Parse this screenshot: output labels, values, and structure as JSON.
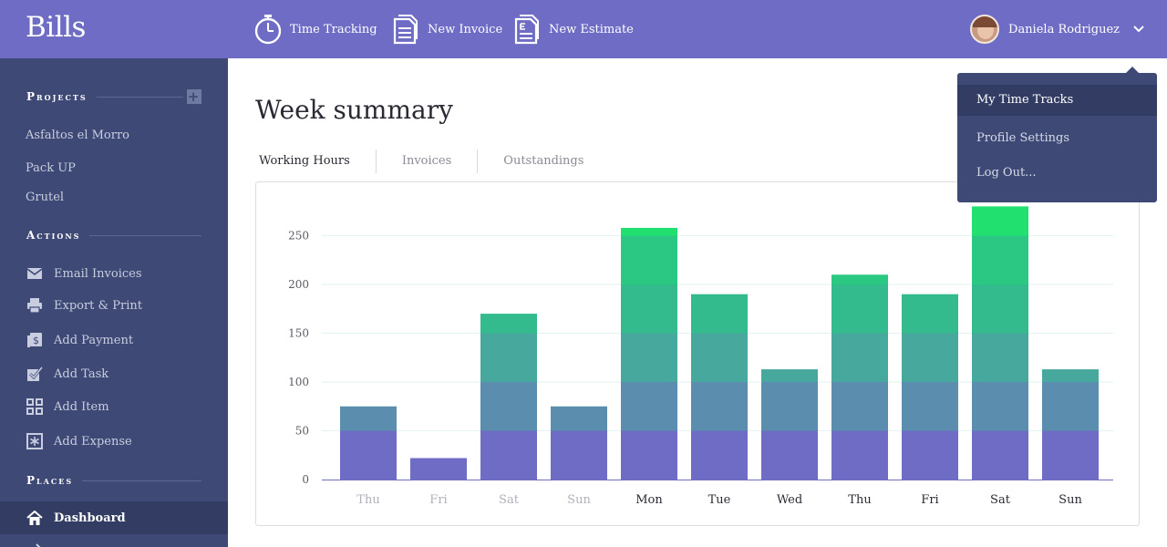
{
  "app": {
    "logo": "Bills"
  },
  "topnav": [
    {
      "label": "Time Tracking",
      "icon": "stopwatch-icon"
    },
    {
      "label": "New Invoice",
      "icon": "document-icon"
    },
    {
      "label": "New Estimate",
      "icon": "estimate-document-icon"
    }
  ],
  "user": {
    "name": "Daniela Rodriguez"
  },
  "sidebar": {
    "projects_heading": "Projects",
    "projects": [
      "Asfaltos el Morro",
      "Pack UP",
      "Grutel"
    ],
    "actions_heading": "Actions",
    "actions": [
      {
        "label": "Email Invoices",
        "icon": "envelope-icon"
      },
      {
        "label": "Export & Print",
        "icon": "printer-icon"
      },
      {
        "label": "Add Payment",
        "icon": "payment-icon"
      },
      {
        "label": "Add Task",
        "icon": "task-check-icon"
      },
      {
        "label": "Add Item",
        "icon": "grid-icon"
      },
      {
        "label": "Add Expense",
        "icon": "expense-icon"
      }
    ],
    "places_heading": "Places",
    "places": [
      {
        "label": "Dashboard",
        "icon": "home-icon"
      }
    ]
  },
  "main": {
    "title": "Week summary",
    "tabs": [
      "Working Hours",
      "Invoices",
      "Outstandings"
    ],
    "active_tab": "Working Hours"
  },
  "dropdown": {
    "items": [
      "My Time Tracks",
      "Profile Settings",
      "Log Out..."
    ],
    "active": "My Time Tracks"
  },
  "colors": {
    "topbar": "#6e6cc4",
    "sidebar": "#3e4a75",
    "band_0_50": "#6e6cc4",
    "band_50_100": "#5a8dae",
    "band_100_150": "#47a99d",
    "band_150_200": "#33bb8e",
    "band_200_250": "#2ac882",
    "band_250_plus": "#22e070"
  },
  "chart_data": {
    "type": "bar",
    "categories": [
      "Thu",
      "Fri",
      "Sat",
      "Sun",
      "Mon",
      "Tue",
      "Wed",
      "Thu",
      "Fri",
      "Sat",
      "Sun"
    ],
    "values": [
      75,
      22,
      170,
      75,
      258,
      190,
      113,
      210,
      190,
      280,
      113
    ],
    "highlighted_categories": [
      false,
      false,
      false,
      false,
      true,
      true,
      true,
      true,
      true,
      true,
      true
    ],
    "ylim": [
      0,
      280
    ],
    "yticks": [
      0,
      50,
      100,
      150,
      200,
      250
    ],
    "grid": true
  }
}
